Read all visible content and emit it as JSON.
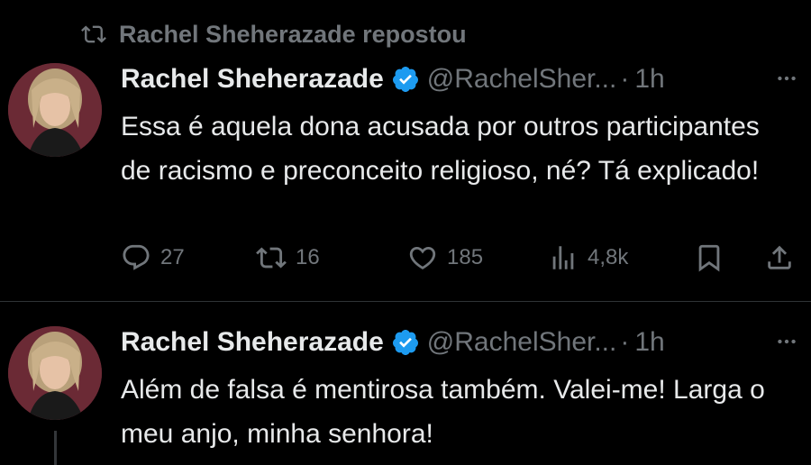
{
  "repost": {
    "text": "Rachel Sheherazade repostou",
    "icon": "repost-icon"
  },
  "tweets": [
    {
      "name": "Rachel Sheherazade",
      "handle": "@RachelSher...",
      "dot": "·",
      "time": "1h",
      "text": "Essa é aquela dona acusada por outros participantes de racismo e preconceito religioso, né? Tá explicado!",
      "replies": "27",
      "reposts": "16",
      "likes": "185",
      "views": "4,8k"
    },
    {
      "name": "Rachel Sheherazade",
      "handle": "@RachelSher...",
      "dot": "·",
      "time": "1h",
      "text": "Além de falsa é mentirosa também. Valei-me! Larga o meu anjo, minha senhora!"
    }
  ],
  "colors": {
    "background": "#000000",
    "text": "#e7e9ea",
    "muted": "#71767b",
    "verified": "#1d9bf0",
    "divider": "#2f3336"
  }
}
